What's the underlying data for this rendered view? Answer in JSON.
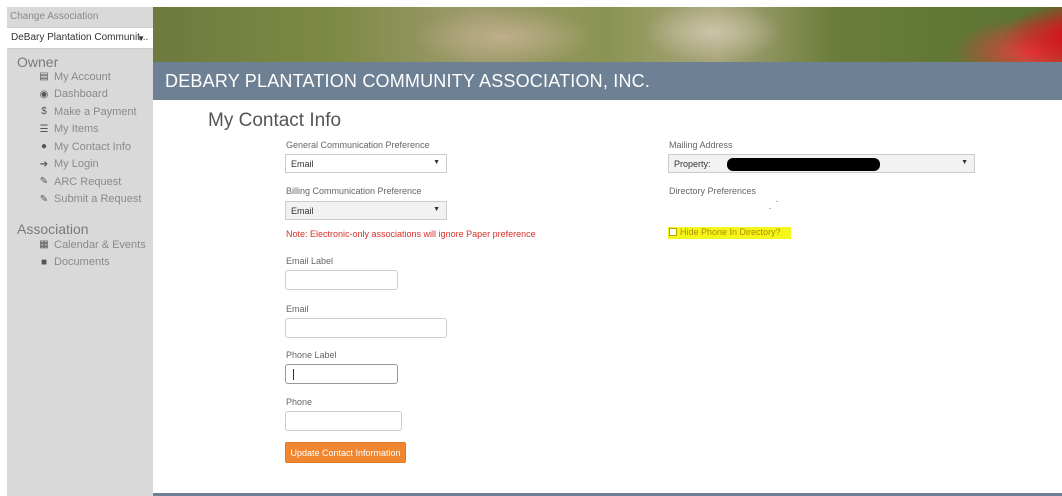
{
  "sidebar": {
    "change_association_label": "Change Association",
    "association_select_value": "DeBary Plantation Communit...",
    "owner_title": "Owner",
    "owner_items": [
      {
        "label": "My Account",
        "icon": "account-icon"
      },
      {
        "label": "Dashboard",
        "icon": "dashboard-icon"
      },
      {
        "label": "Make a Payment",
        "icon": "dollar-icon"
      },
      {
        "label": "My Items",
        "icon": "list-icon"
      },
      {
        "label": "My Contact Info",
        "icon": "user-icon"
      },
      {
        "label": "My Login",
        "icon": "login-icon"
      },
      {
        "label": "ARC Request",
        "icon": "wrench-icon"
      },
      {
        "label": "Submit a Request",
        "icon": "wrench-icon"
      }
    ],
    "association_title": "Association",
    "association_items": [
      {
        "label": "Calendar & Events",
        "icon": "calendar-icon"
      },
      {
        "label": "Documents",
        "icon": "folder-icon"
      }
    ]
  },
  "header": {
    "title": "DEBARY PLANTATION COMMUNITY ASSOCIATION, INC."
  },
  "main": {
    "page_title": "My Contact Info",
    "general_pref_label": "General Communication Preference",
    "general_pref_value": "Email",
    "billing_pref_label": "Billing Communication Preference",
    "billing_pref_value": "Email",
    "note": "Note: Electronic-only associations will ignore Paper preference",
    "email_label_label": "Email Label",
    "email_label_value": "",
    "email_label": "Email",
    "email_value": "",
    "phone_label_label": "Phone Label",
    "phone_label_value": "",
    "phone_label": "Phone",
    "phone_value": "",
    "update_button": "Update Contact Information",
    "mailing_address_label": "Mailing Address",
    "mailing_address_value": "Property:",
    "directory_pref_label": "Directory Preferences",
    "hide_phone_label": "Hide Phone In Directory?",
    "hide_phone_checked": false
  },
  "colors": {
    "header_bar": "#6e8094",
    "button": "#f0862f",
    "note": "#d9302b",
    "highlight": "#f3f71a"
  }
}
